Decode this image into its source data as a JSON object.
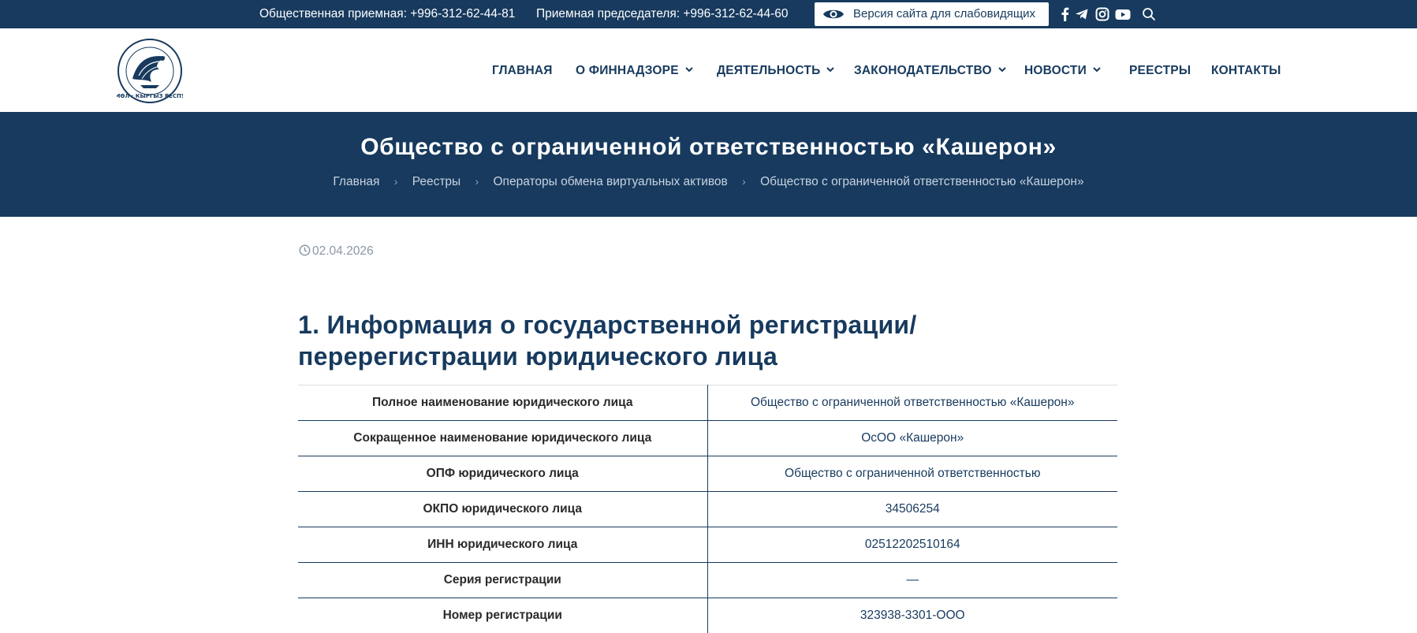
{
  "topbar": {
    "phone_public": "Общественная приемная: +996-312-62-44-81",
    "phone_chair": "Приемная председателя: +996-312-62-44-60",
    "a11y_label": "Версия сайта для слабовидящих",
    "icons": [
      "eye-icon",
      "facebook-icon",
      "telegram-icon",
      "instagram-icon",
      "youtube-icon",
      "search-icon"
    ]
  },
  "logo": {
    "text": "ФИНКӨЗӨМӨЛ · КЫРГЫЗ РЕСПУБЛИКАСЫ"
  },
  "nav": {
    "items": [
      {
        "label": "ГЛАВНАЯ",
        "dropdown": false
      },
      {
        "label": "О ФИННАДЗОРЕ",
        "dropdown": true
      },
      {
        "label": "ДЕЯТЕЛЬНОСТЬ",
        "dropdown": true
      },
      {
        "label": "ЗАКОНОДАТЕЛЬСТВО",
        "dropdown": true
      },
      {
        "label": "НОВОСТИ",
        "dropdown": true
      },
      {
        "label": "РЕЕСТРЫ",
        "dropdown": false
      },
      {
        "label": "КОНТАКТЫ",
        "dropdown": false
      }
    ]
  },
  "hero": {
    "title": "Общество с ограниченной ответственностью «Кашерон»",
    "breadcrumb": [
      "Главная",
      "Реестры",
      "Операторы обмена виртуальных активов",
      "Общество с ограниченной ответственностью «Кашерон»"
    ]
  },
  "content": {
    "date": "02.04.2026",
    "section_title": "1. Информация о государственной регистрации/перерегистрации юридического лица",
    "table": [
      {
        "key": "Полное наименование юридического лица",
        "value": "Общество с ограниченной ответственностью «Кашерон»"
      },
      {
        "key": "Сокращенное наименование юридического лица",
        "value": "ОсОО «Кашерон»"
      },
      {
        "key": "ОПФ юридического лица",
        "value": "Общество с ограниченной ответственностью"
      },
      {
        "key": "ОКПО юридического лица",
        "value": "34506254"
      },
      {
        "key": "ИНН юридического лица",
        "value": "02512202510164"
      },
      {
        "key": "Серия регистрации",
        "value": "—"
      },
      {
        "key": "Номер регистрации",
        "value": "323938-3301-ООО"
      }
    ]
  },
  "colors": {
    "brand_navy": "#173a5e",
    "white": "#ffffff",
    "muted_text": "#8a97a4"
  }
}
